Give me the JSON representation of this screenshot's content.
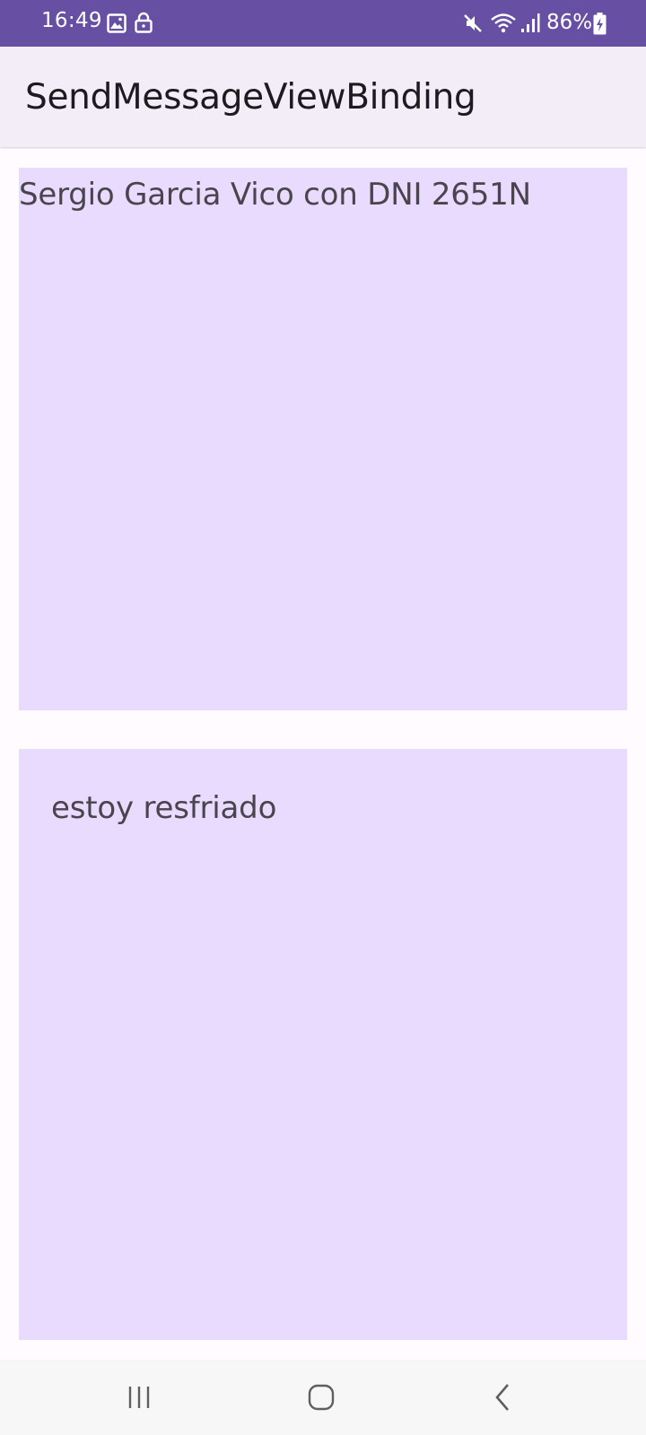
{
  "status_bar": {
    "time": "16:49",
    "battery": "86%",
    "icons": [
      "image-icon",
      "lock-icon",
      "mute-icon",
      "wifi-icon",
      "signal-icon",
      "battery-icon"
    ]
  },
  "app_bar": {
    "title": "SendMessageViewBinding"
  },
  "content": {
    "sender_text": "Sergio Garcia Vico con DNI 2651N",
    "message_text": "estoy resfriado"
  },
  "colors": {
    "status_bar": "#6750a4",
    "app_bar": "#f3edf7",
    "box_background": "#e8dbfd",
    "text": "#49454f"
  },
  "nav_bar": {
    "buttons": [
      "recents-icon",
      "home-icon",
      "back-icon"
    ]
  }
}
